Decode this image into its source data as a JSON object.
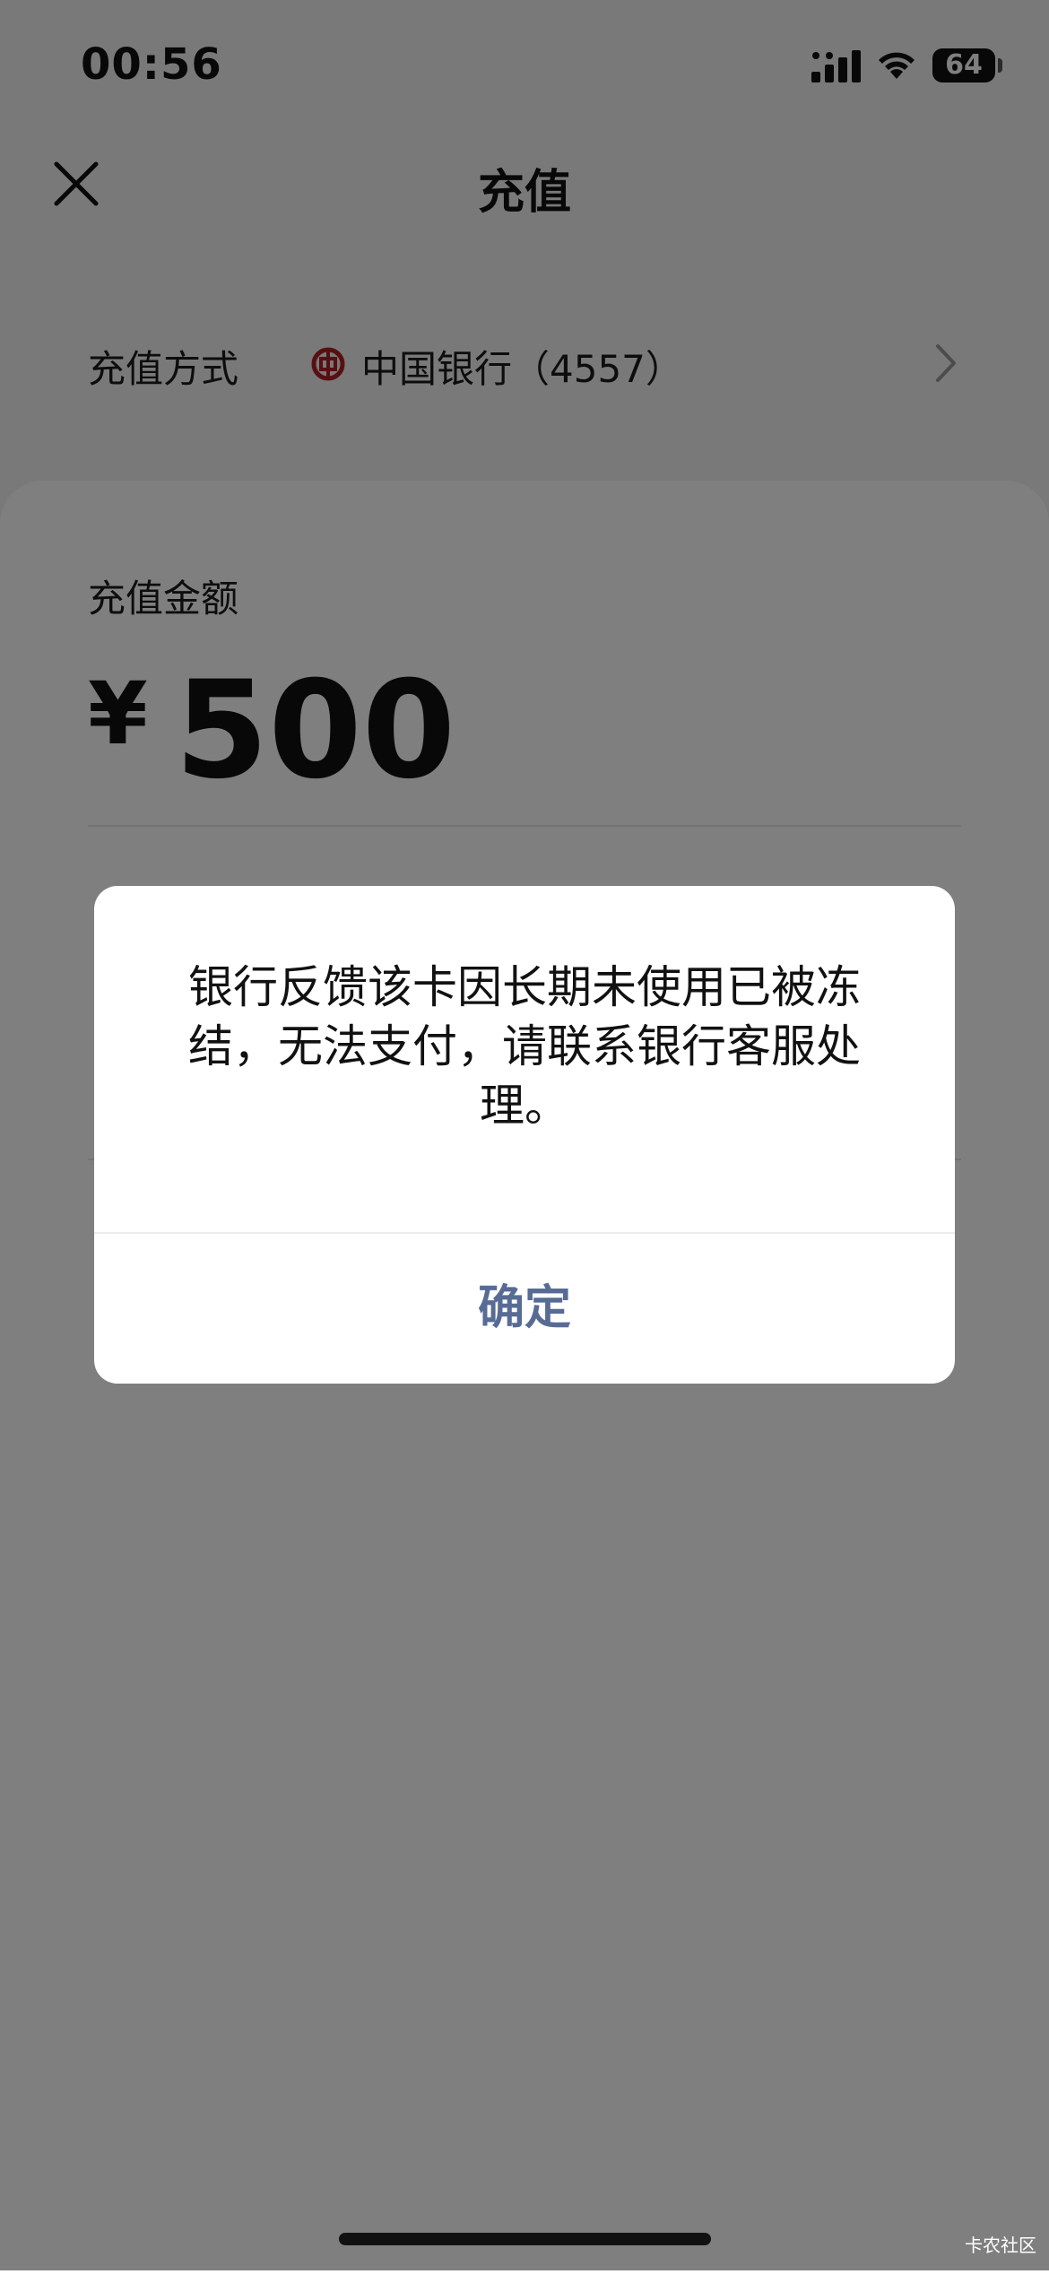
{
  "status_bar": {
    "time": "00:56",
    "battery": "64"
  },
  "nav": {
    "title": "充值",
    "close_icon": "close-icon"
  },
  "payment_method": {
    "label": "充值方式",
    "bank_icon": "bank-of-china-icon",
    "bank": "中国银行（4557）",
    "chevron_icon": "chevron-right-icon"
  },
  "amount": {
    "label": "充值金额",
    "currency": "¥",
    "value": "500"
  },
  "dialog": {
    "message": "银行反馈该卡因长期未使用已被冻结，无法支付，请联系银行客服处理。",
    "confirm_label": "确定",
    "confirm_color": "#576b95"
  },
  "watermark": "卡农社区",
  "colors": {
    "bank_logo": "#b01e23",
    "overlay": "rgba(0,0,0,0.5)"
  }
}
